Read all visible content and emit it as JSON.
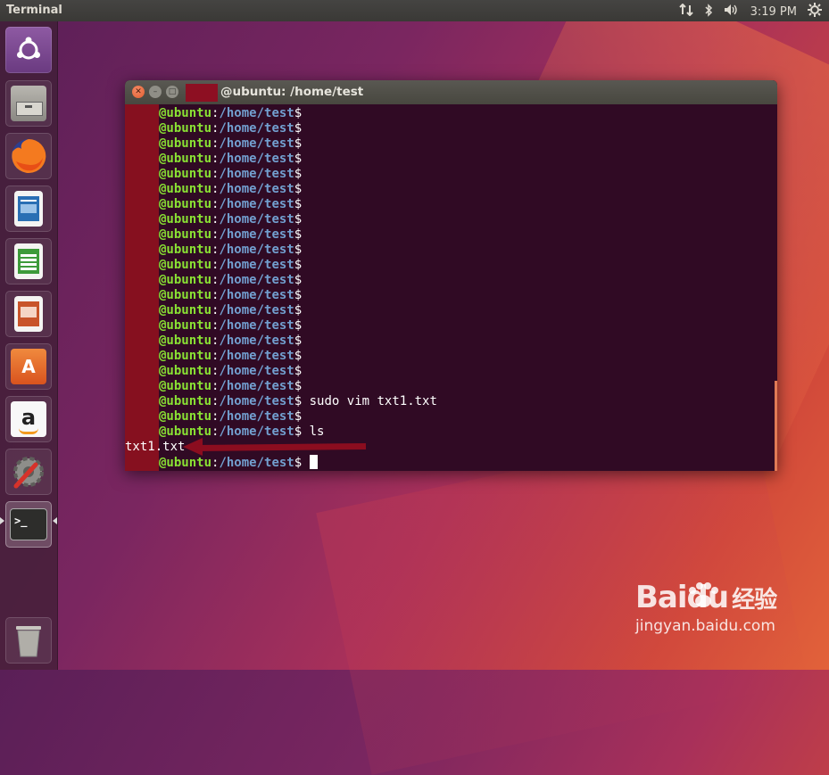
{
  "top_panel": {
    "app_title": "Terminal",
    "clock": "3:19 PM"
  },
  "launcher": {
    "items": [
      {
        "name": "dash-home",
        "color": "#7a4a8f"
      },
      {
        "name": "files",
        "color": "#8a8a86"
      },
      {
        "name": "firefox",
        "color": "#e66000"
      },
      {
        "name": "libreoffice-writer",
        "color": "#2a6fb4"
      },
      {
        "name": "libreoffice-calc",
        "color": "#3d9a3a"
      },
      {
        "name": "libreoffice-impress",
        "color": "#c8542a"
      },
      {
        "name": "ubuntu-software",
        "color": "#e8702e"
      },
      {
        "name": "amazon",
        "color": "#f0f0f0"
      },
      {
        "name": "system-settings",
        "color": "#7a7a78"
      },
      {
        "name": "terminal",
        "color": "#2e2e2e"
      },
      {
        "name": "trash",
        "color": "#8a8a86"
      }
    ]
  },
  "terminal": {
    "title": "@ubuntu: /home/test",
    "prompt_host": "@ubuntu",
    "prompt_sep": ":",
    "prompt_path": "/home/test",
    "prompt_dollar": "$",
    "cmd_vim": "sudo vim txt1.txt",
    "cmd_ls": "ls",
    "ls_output": "txt1.txt"
  },
  "watermark": {
    "brand": "Bai",
    "brand2": "du",
    "brand_cn": "经验",
    "url": "jingyan.baidu.com"
  },
  "colors": {
    "terminal_bg": "#300a24",
    "prompt_host": "#8ae234",
    "prompt_path": "#729fcf",
    "redaction": "#86101f"
  }
}
